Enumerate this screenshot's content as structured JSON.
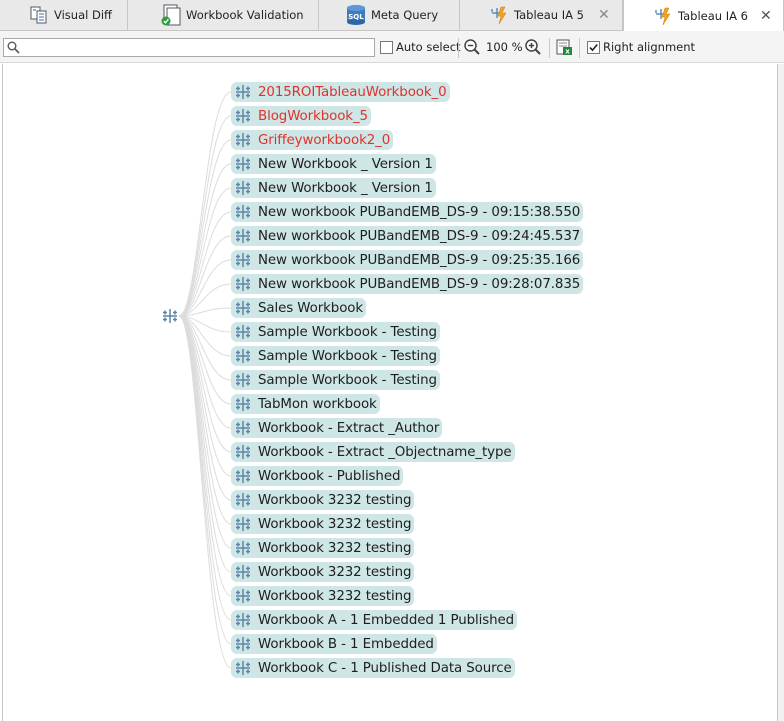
{
  "tabs": [
    {
      "label": "Visual Diff",
      "icon": "visual-diff-icon",
      "closable": false,
      "active": false
    },
    {
      "label": "Workbook Validation",
      "icon": "workbook-validation-icon",
      "closable": false,
      "active": false
    },
    {
      "label": "Meta Query",
      "icon": "sql-database-icon",
      "closable": false,
      "active": false
    },
    {
      "label": "Tableau IA 5",
      "icon": "tableau-ia-icon",
      "closable": true,
      "active": false
    },
    {
      "label": "Tableau IA 6",
      "icon": "tableau-ia-icon",
      "closable": true,
      "active": true
    }
  ],
  "toolbar": {
    "search_value": "",
    "auto_select_label": "Auto select",
    "auto_select_checked": false,
    "zoom_level": "100 %",
    "right_alignment_label": "Right alignment",
    "right_alignment_checked": true
  },
  "tree": {
    "root_icon": "tableau-node-icon",
    "nodes": [
      {
        "label": "2015ROITableauWorkbook_0",
        "status": "error"
      },
      {
        "label": "BlogWorkbook_5",
        "status": "error"
      },
      {
        "label": "Griffeyworkbook2_0",
        "status": "error"
      },
      {
        "label": "New Workbook _ Version 1",
        "status": "ok"
      },
      {
        "label": "New Workbook _ Version 1",
        "status": "ok"
      },
      {
        "label": "New workbook PUBandEMB_DS-9 - 09:15:38.550",
        "status": "ok"
      },
      {
        "label": "New workbook PUBandEMB_DS-9 - 09:24:45.537",
        "status": "ok"
      },
      {
        "label": "New workbook PUBandEMB_DS-9 - 09:25:35.166",
        "status": "ok"
      },
      {
        "label": "New workbook PUBandEMB_DS-9 - 09:28:07.835",
        "status": "ok"
      },
      {
        "label": "Sales Workbook",
        "status": "ok"
      },
      {
        "label": "Sample Workbook -  Testing",
        "status": "ok"
      },
      {
        "label": "Sample Workbook -  Testing",
        "status": "ok"
      },
      {
        "label": "Sample Workbook -  Testing",
        "status": "ok"
      },
      {
        "label": "TabMon workbook",
        "status": "ok"
      },
      {
        "label": "Workbook - Extract _Author",
        "status": "ok"
      },
      {
        "label": "Workbook - Extract _Objectname_type",
        "status": "ok"
      },
      {
        "label": "Workbook - Published",
        "status": "ok"
      },
      {
        "label": "Workbook 3232 testing",
        "status": "ok"
      },
      {
        "label": "Workbook 3232 testing",
        "status": "ok"
      },
      {
        "label": "Workbook 3232 testing",
        "status": "ok"
      },
      {
        "label": "Workbook 3232 testing",
        "status": "ok"
      },
      {
        "label": "Workbook 3232 testing",
        "status": "ok"
      },
      {
        "label": "Workbook A - 1 Embedded 1 Published",
        "status": "ok"
      },
      {
        "label": "Workbook B - 1 Embedded",
        "status": "ok"
      },
      {
        "label": "Workbook C - 1 Published Data Source",
        "status": "ok"
      }
    ]
  },
  "colors": {
    "node_fill": "#cfe6e6",
    "node_error_text": "#e0322c",
    "node_text": "#1e1e1e",
    "tableau_icon": "#5a86a8",
    "edge": "#dcdcdc"
  }
}
